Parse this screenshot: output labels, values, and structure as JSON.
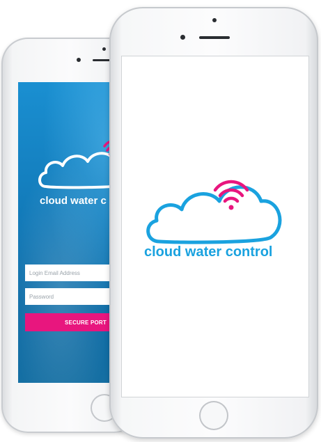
{
  "brand": {
    "name": "cloud water control",
    "accent_color": "#e8167e",
    "cloud_color": "#1aa2df"
  },
  "login_screen": {
    "logo_text": "cloud water c",
    "email_placeholder": "Login Email Address",
    "password_placeholder": "Password",
    "submit_label": "SECURE PORT"
  },
  "splash_screen": {
    "logo_text": "cloud water control"
  },
  "icons": {
    "logo": "cloud-wifi-icon",
    "home": "home-button-icon"
  }
}
